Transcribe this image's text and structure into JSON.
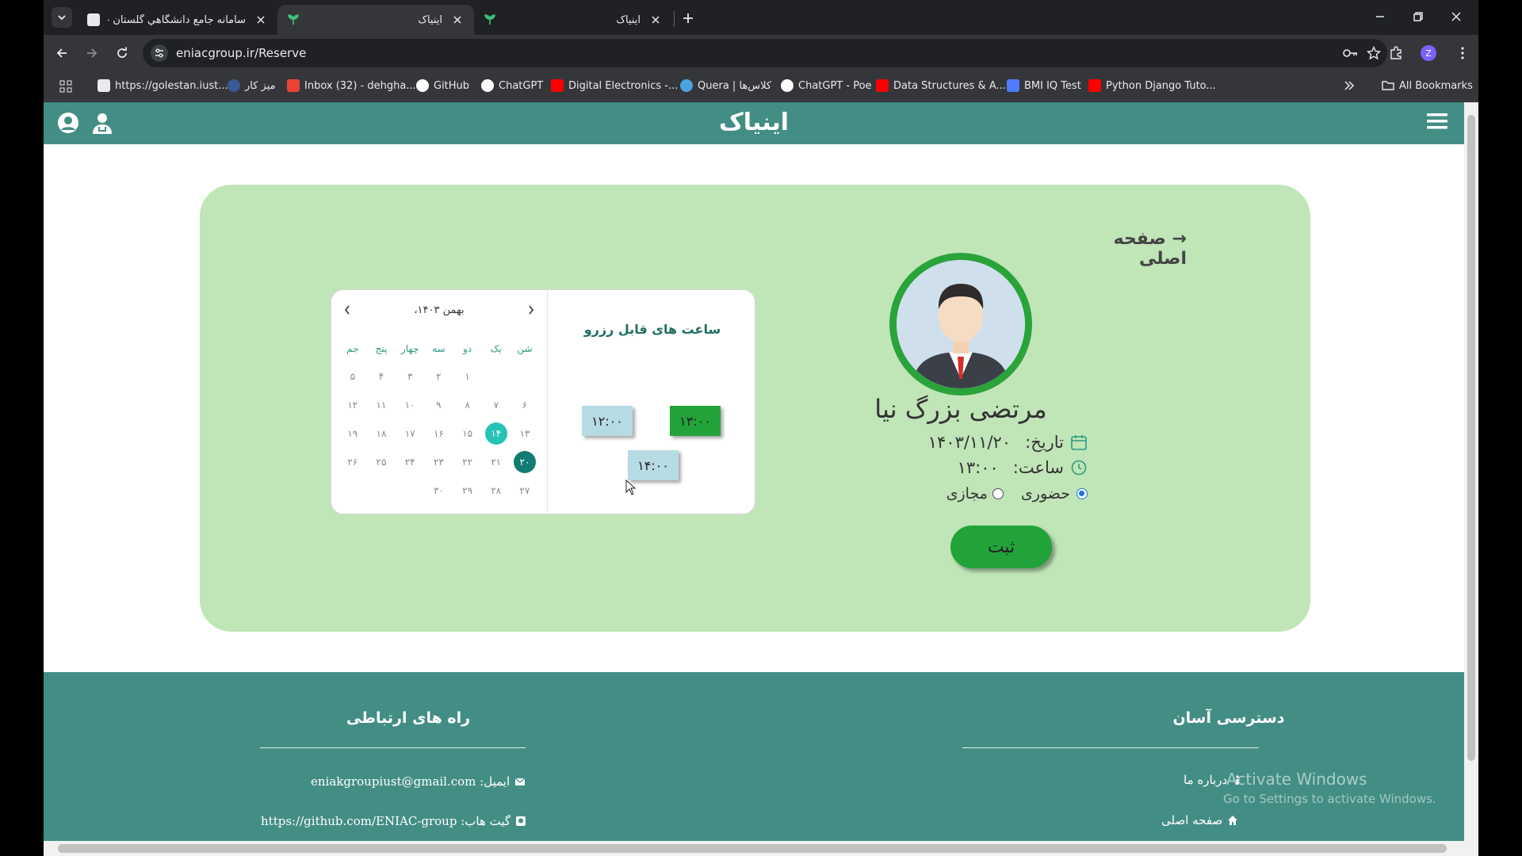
{
  "browser": {
    "tabs": [
      {
        "title": "سامانه جامع دانشگاهي گلستان -",
        "active": false
      },
      {
        "title": "اینیاک",
        "active": true
      },
      {
        "title": "اینیاک",
        "active": false
      }
    ],
    "url": "eniacgroup.ir/Reserve",
    "bookmarks": [
      {
        "label": "https://golestan.iust...",
        "color": "#e8eaed"
      },
      {
        "label": "میز کار",
        "color": "#3b5998"
      },
      {
        "label": "Inbox (32) - dehgha...",
        "color": "#ea4335"
      },
      {
        "label": "GitHub",
        "color": "#ffffff"
      },
      {
        "label": "ChatGPT",
        "color": "#ffffff"
      },
      {
        "label": "Digital Electronics -...",
        "color": "#ff0000"
      },
      {
        "label": "Quera | کلاس‌ها",
        "color": "#4aa3df"
      },
      {
        "label": "ChatGPT - Poe",
        "color": "#ffffff"
      },
      {
        "label": "Data Structures & A...",
        "color": "#ff0000"
      },
      {
        "label": "BMI IQ Test",
        "color": "#4f7cff"
      },
      {
        "label": "Python Django Tuto...",
        "color": "#ff0000"
      }
    ],
    "all_bookmarks": "All Bookmarks",
    "profile_initial": "Z"
  },
  "site": {
    "brand": "اینیاک",
    "back_link": "→ صفحه اصلی",
    "doctor_name": "مرتضی بزرگ نیا",
    "date_label": "تاریخ:",
    "date_value": "۱۴۰۳/۱۱/۲۰",
    "time_label": "ساعت:",
    "time_value": "۱۳:۰۰",
    "mode_in_person": "حضوری",
    "mode_virtual": "مجازی",
    "selected_mode": "in_person",
    "submit": "ثبت",
    "slots_title": "ساعت های قابل رزرو",
    "slots": [
      {
        "time": "۱۳:۰۰",
        "selected": true
      },
      {
        "time": "۱۲:۰۰",
        "selected": false
      },
      {
        "time": "۱۴:۰۰",
        "selected": false
      }
    ],
    "calendar": {
      "month_label": "بهمن ۱۴۰۳،",
      "weekdays": [
        "شن",
        "یک",
        "دو",
        "سه",
        "چهار",
        "پنج",
        "جم"
      ],
      "weeks": [
        [
          "",
          "",
          "۱",
          "۲",
          "۳",
          "۴",
          "۵"
        ],
        [
          "۶",
          "۷",
          "۸",
          "۹",
          "۱۰",
          "۱۱",
          "۱۲"
        ],
        [
          "۱۳",
          "۱۴",
          "۱۵",
          "۱۶",
          "۱۷",
          "۱۸",
          "۱۹"
        ],
        [
          "۲۰",
          "۲۱",
          "۲۲",
          "۲۳",
          "۲۴",
          "۲۵",
          "۲۶"
        ],
        [
          "۲۷",
          "۲۸",
          "۲۹",
          "۳۰",
          "",
          "",
          ""
        ]
      ],
      "today": "۱۴",
      "selected": "۲۰"
    },
    "footer": {
      "contact_title": "راه های ارتباطی",
      "email": "ایمیل: eniakgroupiust@gmail.com",
      "github": "گیت هاب: https://github.com/ENIAC-group",
      "access_title": "دسترسی آسان",
      "about": "درباره ما",
      "home": "صفحه اصلی"
    }
  },
  "os": {
    "watermark_title": "Activate Windows",
    "watermark_sub": "Go to Settings to activate Windows."
  },
  "colors": {
    "navbar": "#438e84",
    "card": "#c0e5b7",
    "accent_green": "#22a33a",
    "today": "#24c3b4",
    "selected_day": "#127c72"
  }
}
